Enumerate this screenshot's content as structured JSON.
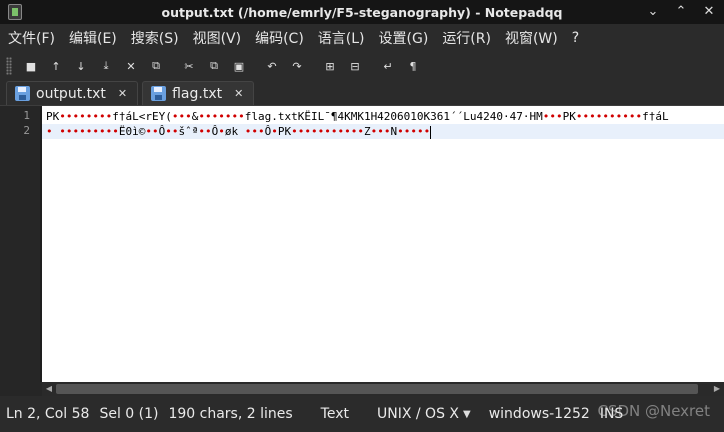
{
  "window": {
    "title": "output.txt (/home/emrly/F5-steganography) - Notepadqq",
    "controls": [
      "⌄",
      "⌃",
      "✕"
    ]
  },
  "menu": [
    "文件(F)",
    "编辑(E)",
    "搜索(S)",
    "视图(V)",
    "编码(C)",
    "语言(L)",
    "设置(G)",
    "运行(R)",
    "视窗(W)",
    "?"
  ],
  "toolbar_icons": [
    {
      "name": "new-file-icon",
      "glyph": "■"
    },
    {
      "name": "open-file-icon",
      "glyph": "↑"
    },
    {
      "name": "save-file-icon",
      "glyph": "↓"
    },
    {
      "name": "save-all-icon",
      "glyph": "⤓"
    },
    {
      "name": "close-file-icon",
      "glyph": "✕"
    },
    {
      "name": "close-all-icon",
      "glyph": "⧉"
    },
    {
      "name": "cut-icon",
      "glyph": "✂"
    },
    {
      "name": "copy-icon",
      "glyph": "⧉"
    },
    {
      "name": "paste-icon",
      "glyph": "▣"
    },
    {
      "name": "undo-icon",
      "glyph": "↶"
    },
    {
      "name": "redo-icon",
      "glyph": "↷"
    },
    {
      "name": "zoom-in-icon",
      "glyph": "⊞"
    },
    {
      "name": "zoom-out-icon",
      "glyph": "⊟"
    },
    {
      "name": "word-wrap-icon",
      "glyph": "↵"
    },
    {
      "name": "show-all-chars-icon",
      "glyph": "¶"
    }
  ],
  "tabs": [
    {
      "label": "output.txt",
      "close": "✕"
    },
    {
      "label": "flag.txt",
      "close": "✕"
    }
  ],
  "editor": {
    "line_numbers": [
      "1",
      "2"
    ],
    "lines": [
      "PK••••••••f†áL<rEY(•••&•••••••flag.txtKËIL¯¶4KMK1H4206010K361´´Lu4240·47·HM•••PK••••••••••f†áL",
      "• •••••••••Ë0ì©••Ô••šˆª••Ô•øk •••Ô•PK•••••••••••Z•••N•••••"
    ]
  },
  "status": {
    "position": "Ln 2, Col 58",
    "selection": "Sel 0 (1)",
    "size": "190 chars, 2 lines",
    "language": "Text",
    "eol": "UNIX / OS X",
    "encoding": "windows-1252",
    "mode": "INS"
  },
  "watermark": "CSDN @Nexret"
}
